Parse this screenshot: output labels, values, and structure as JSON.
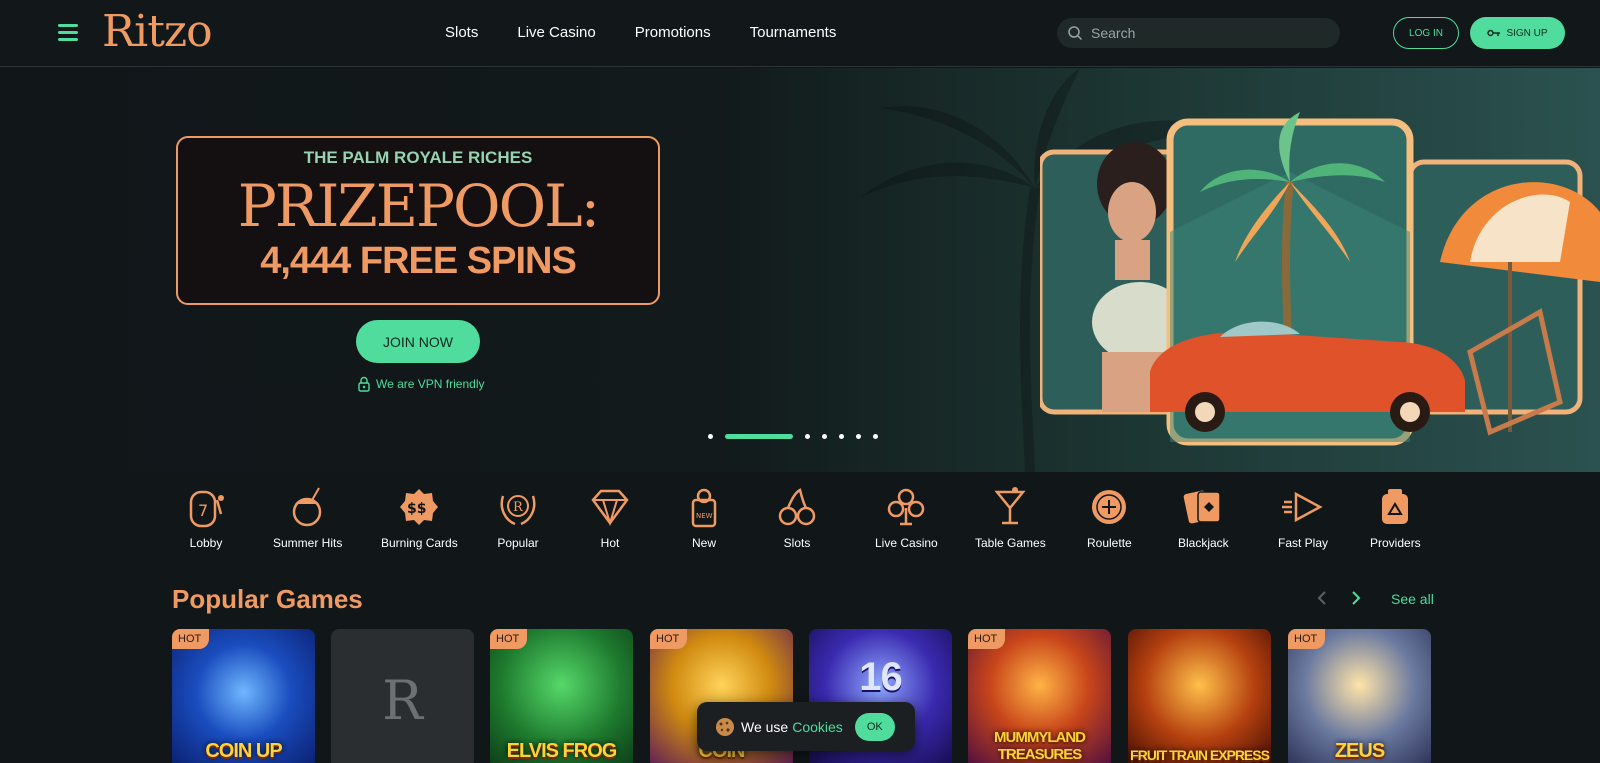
{
  "header": {
    "logo": "Ritzo",
    "nav": [
      "Slots",
      "Live Casino",
      "Promotions",
      "Tournaments"
    ],
    "search_placeholder": "Search",
    "login_label": "LOG IN",
    "signup_label": "SIGN UP"
  },
  "hero": {
    "subtitle": "THE PALM ROYALE RICHES",
    "title": "PRIZEPOOL:",
    "spins": "4,444 FREE SPINS",
    "cta": "JOIN NOW",
    "vpn": "We are VPN friendly",
    "slides_total": 7,
    "active_slide": 2
  },
  "categories": [
    {
      "label": "Lobby",
      "icon": "slot-machine-icon"
    },
    {
      "label": "Summer Hits",
      "icon": "coconut-drink-icon"
    },
    {
      "label": "Burning Cards",
      "icon": "dollar-badge-icon"
    },
    {
      "label": "Popular",
      "icon": "laurel-icon"
    },
    {
      "label": "Hot",
      "icon": "diamond-icon"
    },
    {
      "label": "New",
      "icon": "door-hanger-icon"
    },
    {
      "label": "Slots",
      "icon": "cherries-icon"
    },
    {
      "label": "Live Casino",
      "icon": "club-icon"
    },
    {
      "label": "Table Games",
      "icon": "cocktail-icon"
    },
    {
      "label": "Roulette",
      "icon": "roulette-icon"
    },
    {
      "label": "Blackjack",
      "icon": "cards-icon"
    },
    {
      "label": "Fast Play",
      "icon": "fast-play-icon"
    },
    {
      "label": "Providers",
      "icon": "providers-icon"
    }
  ],
  "popular": {
    "title": "Popular Games",
    "see_all": "See all",
    "games": [
      {
        "name": "COIN UP",
        "hot": "HOT"
      },
      {
        "name": "",
        "hot": ""
      },
      {
        "name": "ELVIS FROG",
        "hot": "HOT"
      },
      {
        "name": "COIN",
        "hot": "HOT"
      },
      {
        "name": "16",
        "hot": ""
      },
      {
        "name": "MUMMYLAND TREASURES",
        "hot": "HOT"
      },
      {
        "name": "FRUIT TRAIN EXPRESS",
        "hot": ""
      },
      {
        "name": "ZEUS",
        "hot": "HOT"
      }
    ],
    "placeholder_letter": "R"
  },
  "cookie": {
    "text": "We use",
    "link": "Cookies",
    "ok": "OK"
  },
  "colors": {
    "accent_green": "#4fdc9c",
    "accent_orange": "#ef9a63",
    "background": "#111619"
  }
}
